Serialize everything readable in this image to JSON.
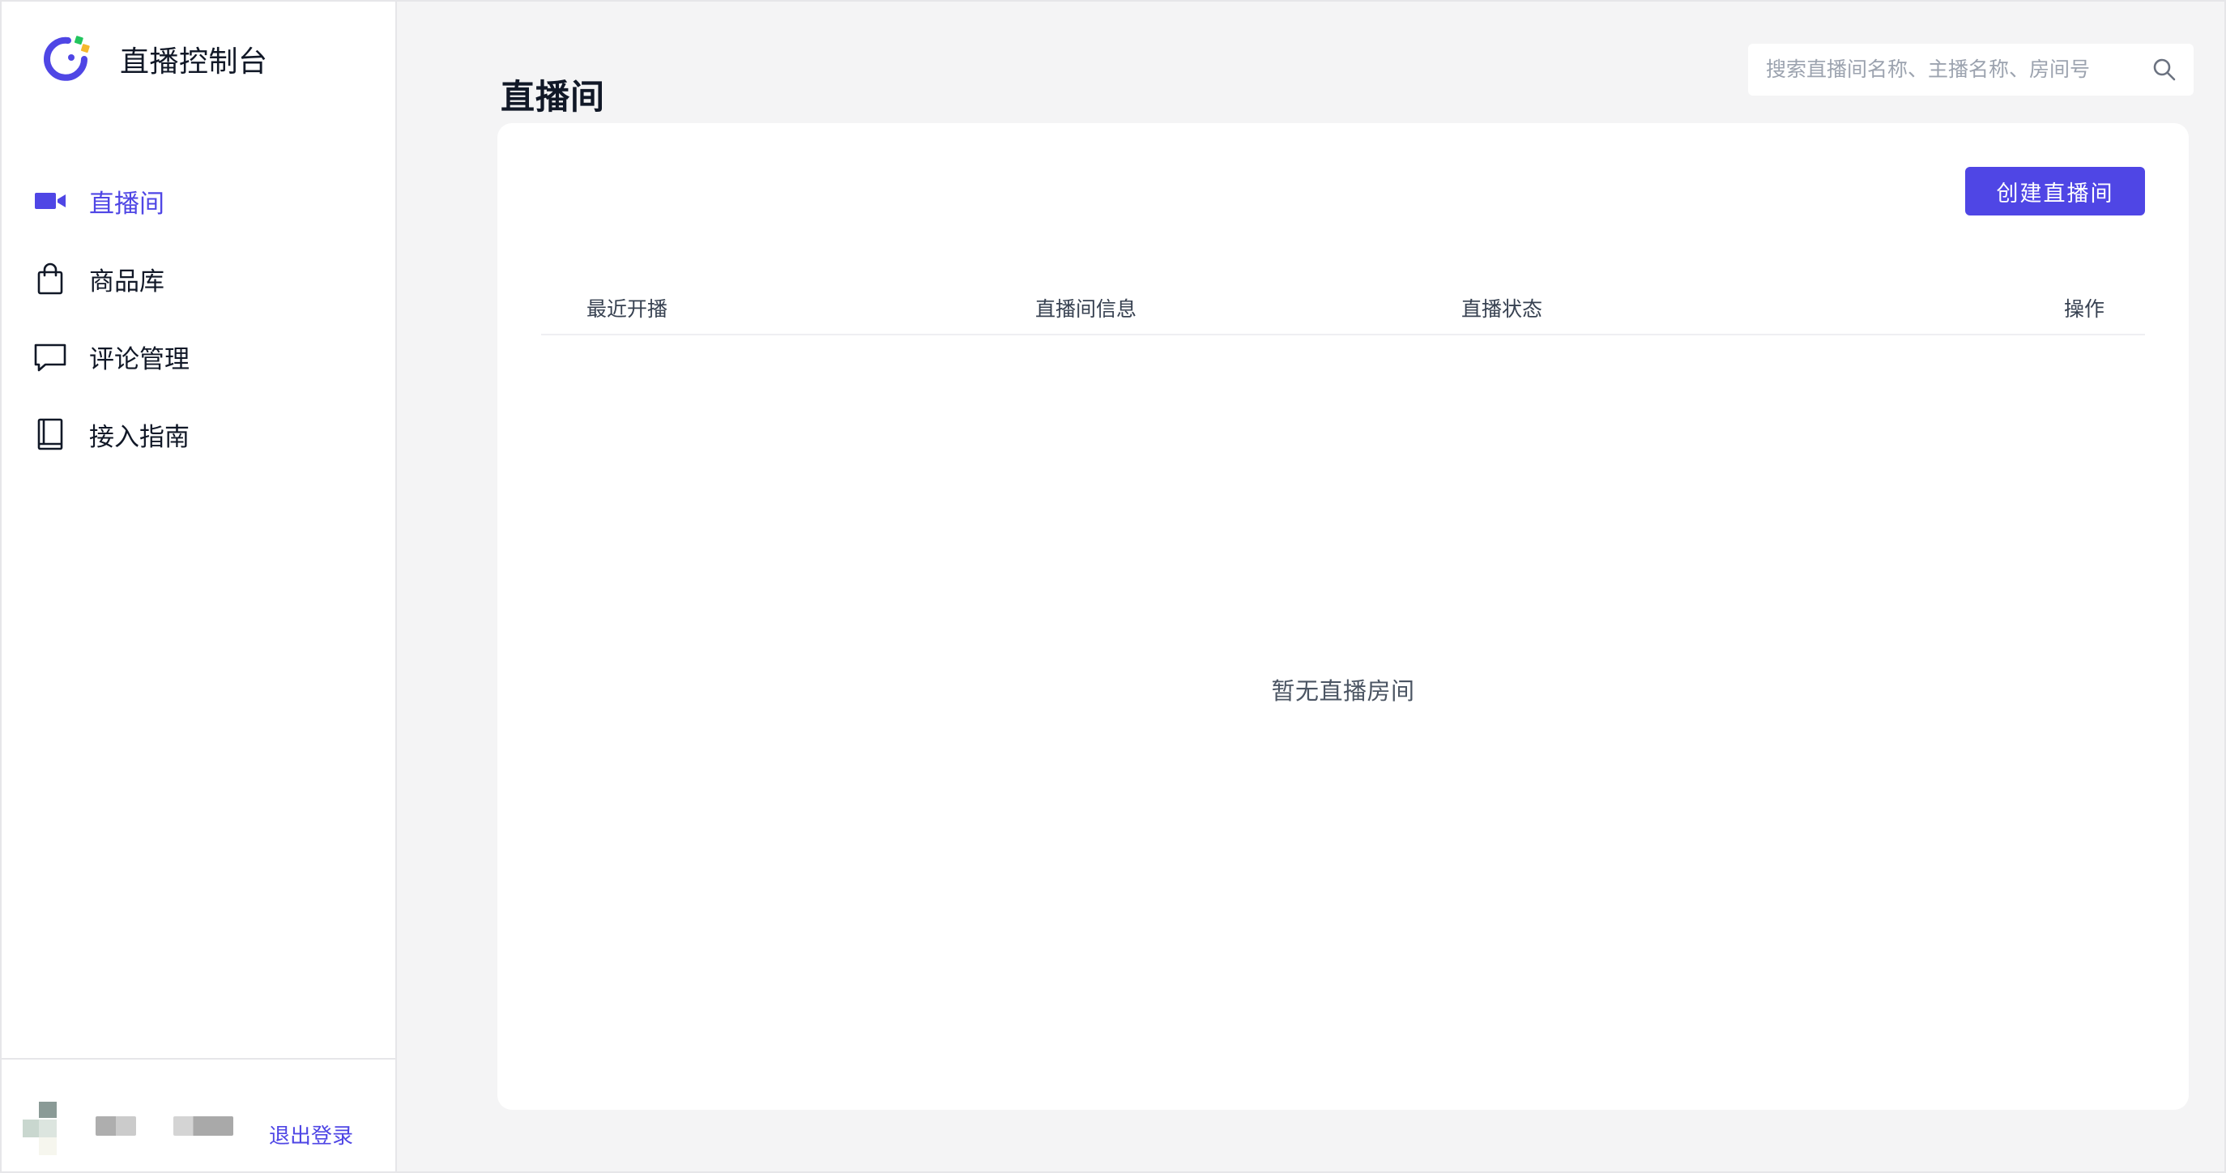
{
  "app": {
    "title": "直播控制台",
    "accent": "#4F46E5"
  },
  "sidebar": {
    "items": [
      {
        "label": "直播间",
        "icon": "video-camera-icon",
        "active": true
      },
      {
        "label": "商品库",
        "icon": "shopping-bag-icon",
        "active": false
      },
      {
        "label": "评论管理",
        "icon": "comment-icon",
        "active": false
      },
      {
        "label": "接入指南",
        "icon": "book-icon",
        "active": false
      }
    ],
    "footer": {
      "logout_label": "退出登录"
    }
  },
  "header": {
    "page_title": "直播间",
    "search": {
      "placeholder": "搜索直播间名称、主播名称、房间号",
      "value": ""
    }
  },
  "main": {
    "create_button_label": "创建直播间",
    "table": {
      "columns": [
        "最近开播",
        "直播间信息",
        "直播状态",
        "操作"
      ],
      "rows": []
    },
    "empty_text": "暂无直播房间"
  }
}
